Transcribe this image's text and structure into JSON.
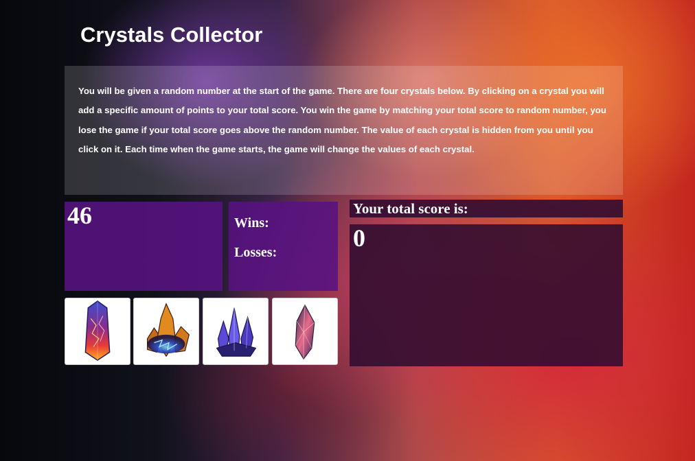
{
  "page": {
    "title": "Crystals Collector",
    "instructions": "You will be given a random number at the start of the game. There are four crystals below. By clicking on a crystal you will add a specific amount of points to your total score. You win the game by matching your total score to random number, you lose the game if your total score goes above the random number. The value of each crystal is hidden from you until you click on it. Each time when the game starts, the game will change the values of each crystal."
  },
  "game": {
    "target_number": "46",
    "wins_label": "Wins:",
    "losses_label": "Losses:",
    "score_label": "Your total score is:",
    "total_score": "0"
  },
  "crystals": [
    {
      "icon": "red-orange-crystal-icon"
    },
    {
      "icon": "amber-blue-crystal-cluster-icon"
    },
    {
      "icon": "blue-violet-crystal-cluster-icon"
    },
    {
      "icon": "pink-gem-crystal-icon"
    }
  ],
  "colors": {
    "panel_purple": "#58128a",
    "score_panel": "#300c30",
    "text": "#ffffff"
  }
}
